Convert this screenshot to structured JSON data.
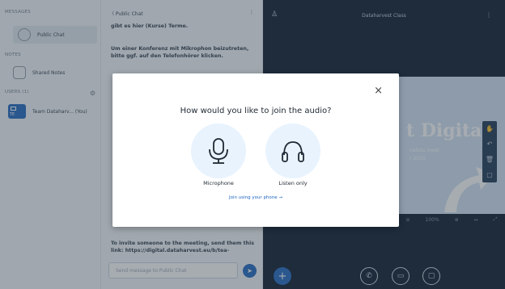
{
  "sidebar": {
    "messages_header": "MESSAGES",
    "public_chat": "Public Chat",
    "notes_header": "NOTES",
    "shared_notes": "Shared Notes",
    "users_header": "USERS (1)",
    "user_initials": "TE",
    "user_name": "Team Dataharv... (You)"
  },
  "chat": {
    "back_title": "〈 Public Chat",
    "menu": "⋮",
    "msg_top": "gibt es hier (Kurse) Terme.",
    "msg_conf": "Um einer Konferenz mit Mikrophon beizutreten, bitte ggf. auf den Telefonhörer klicken.",
    "msg_invite": "To invite someone to the meeting, send them this link: https://digital.dataharvest.eu/b/tea-",
    "input_placeholder": "Send message to Public Chat"
  },
  "stage": {
    "title": "Dataharvest Class",
    "slide_title": "t Digital",
    "slide_sub1": "nalists meet",
    "slide_sub2": "r 2020",
    "zoom": "100%"
  },
  "modal": {
    "title": "How would you like to join the audio?",
    "microphone": "Microphone",
    "listen_only": "Listen only",
    "phone_link": "Join using your phone →",
    "close": "×"
  },
  "colors": {
    "accent": "#1c65c0",
    "option_bg": "#e8f3fe",
    "stage_bg": "#06172a"
  }
}
